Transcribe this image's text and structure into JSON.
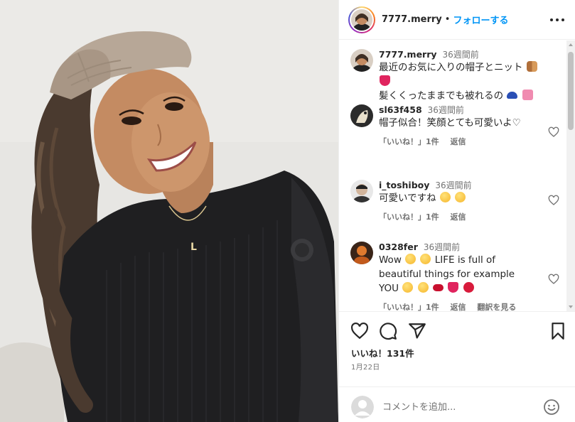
{
  "post": {
    "image_alt": "Selfie of a woman wearing a beige knit visor cap and black knit sweater"
  },
  "header": {
    "username": "7777.merry",
    "separator": "•",
    "follow_label": "フォローする",
    "more_icon": "more-horizontal-icon"
  },
  "caption": {
    "username": "7777.merry",
    "time": "36週間前",
    "line1": "最近のお気に入りの帽子とニット",
    "line2": "髪くくったままでも被れるの"
  },
  "comments": [
    {
      "username": "sl63f458",
      "time": "36週間前",
      "text": "帽子似合！笑顔とても可愛いよ♡",
      "likes": "「いいね！」1件",
      "reply": "返信"
    },
    {
      "username": "i_toshiboy",
      "time": "36週間前",
      "text": "可愛いですね",
      "likes": "「いいね！」1件",
      "reply": "返信"
    },
    {
      "username": "0328fer",
      "time": "36週間前",
      "text_line1": "Wow",
      "text_line2": "LIFE is full of",
      "text_line3": "beautiful things for example",
      "text_line4": "YOU",
      "likes": "「いいね！」1件",
      "reply": "返信",
      "translate": "翻訳を見る"
    }
  ],
  "actions": {
    "likes_text": "いいね！131件",
    "date_text": "1月22日"
  },
  "add_comment": {
    "placeholder": "コメントを追加..."
  },
  "colors": {
    "accent": "#0095f6",
    "text": "#262626",
    "muted": "#737373",
    "border": "#efefef"
  }
}
